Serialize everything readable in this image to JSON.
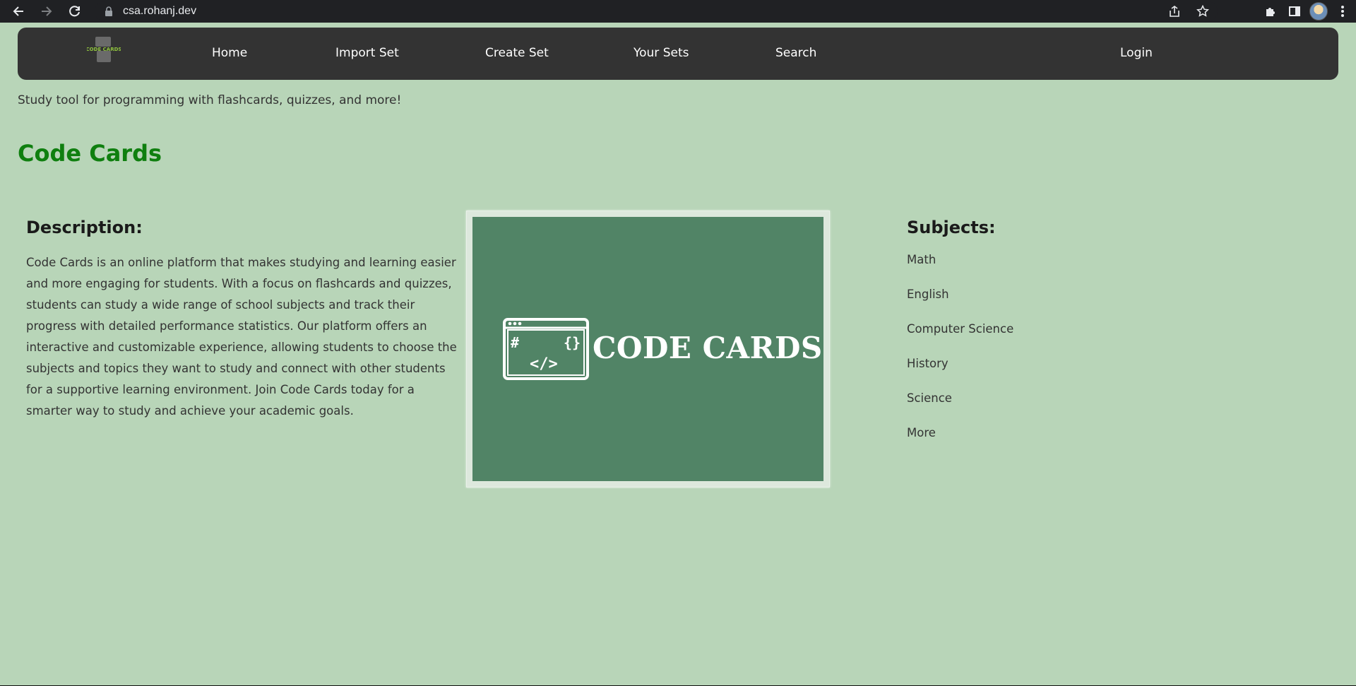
{
  "browser": {
    "url": "csa.rohanj.dev",
    "icons": [
      "back-icon",
      "forward-icon",
      "reload-icon",
      "lock-icon",
      "share-icon",
      "star-icon",
      "extensions-icon",
      "side-panel-icon",
      "profile-avatar",
      "menu-icon"
    ]
  },
  "nav": {
    "logo_text": "CODE CARDS",
    "links": {
      "home": "Home",
      "import_set": "Import Set",
      "create_set": "Create Set",
      "your_sets": "Your Sets",
      "search": "Search",
      "login": "Login"
    }
  },
  "tagline": "Study tool for programming with flashcards, quizzes, and more!",
  "title": "Code Cards",
  "description": {
    "heading": "Description:",
    "body": "Code Cards is an online platform that makes studying and learning easier and more engaging for students. With a focus on flashcards and quizzes, students can study a wide range of school subjects and track their progress with detailed performance statistics. Our platform offers an interactive and customizable experience, allowing students to choose the subjects and topics they want to study and connect with other students for a supportive learning environment. Join Code Cards today for a smarter way to study and achieve your academic goals."
  },
  "banner": {
    "text": "CODE CARDS",
    "icon_glyphs": [
      "#",
      "{}",
      "</>"
    ],
    "background_color": "#518466"
  },
  "subjects": {
    "heading": "Subjects:",
    "items": [
      "Math",
      "English",
      "Computer Science",
      "History",
      "Science",
      "More"
    ]
  },
  "colors": {
    "page_background": "#b8d5b8",
    "navbar": "#333333",
    "title_green": "#0f7f0f"
  }
}
